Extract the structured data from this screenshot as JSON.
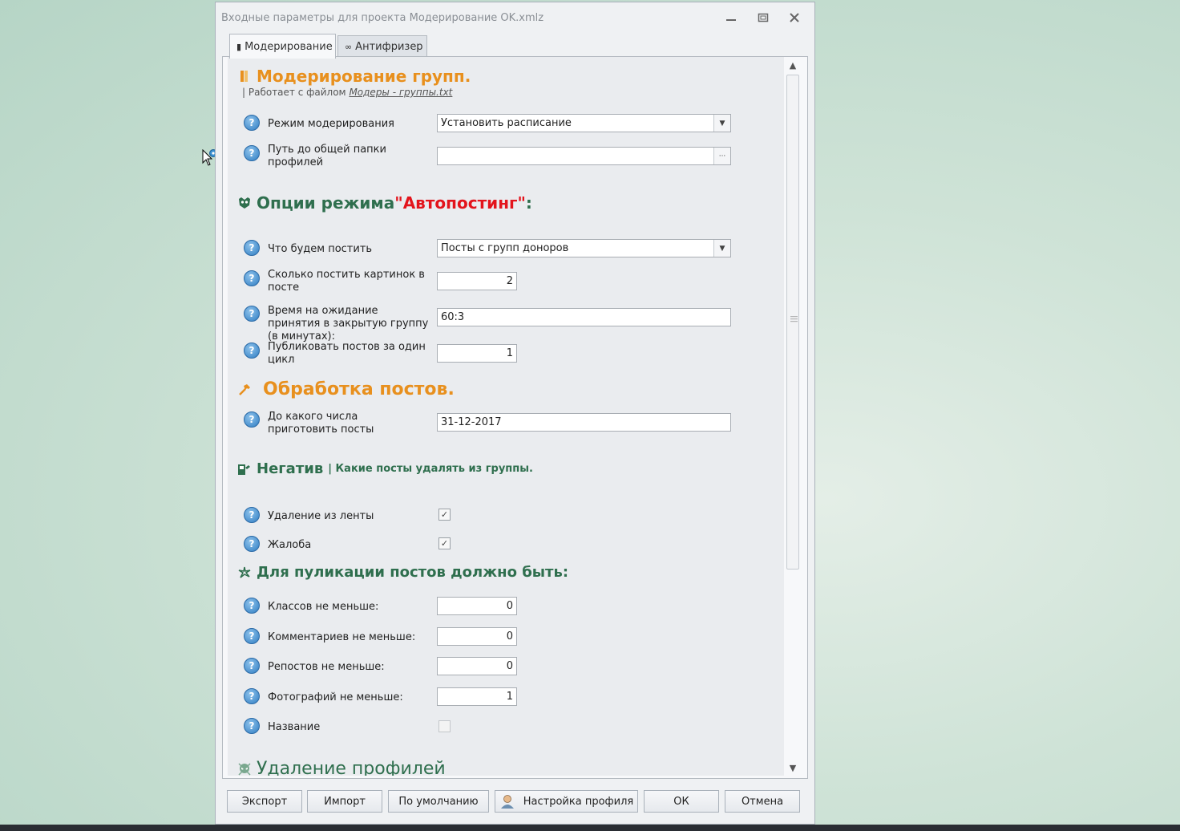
{
  "window": {
    "title": "Входные параметры для проекта Модерирование OK.xmlz",
    "minimize": "—",
    "restore": "❐",
    "close": "✕"
  },
  "tabs": [
    {
      "label": "Модерирование",
      "icon": "▮"
    },
    {
      "label": "Антифризер",
      "icon": "∞"
    }
  ],
  "sections": {
    "moderation": {
      "title": "Модерирование групп.",
      "note_prefix": "| Работает с файлом ",
      "note_link": "Модеры - группы.txt"
    },
    "autopost": {
      "title_prefix": "Опции режима ",
      "title_highlight": "\"Автопостинг\"",
      "title_suffix": ":"
    },
    "processing": {
      "title": "Обработка постов."
    },
    "negative": {
      "title": "Негатив",
      "desc": "| Какие посты удалять из группы."
    },
    "publish": {
      "title": "Для пуликации постов должно быть:"
    },
    "profiles": {
      "title": "Удаление профилей"
    }
  },
  "fields": {
    "mode": {
      "label": "Режим модерирования",
      "value": "Установить расписание"
    },
    "folder": {
      "label": "Путь до общей папки профилей",
      "value": "",
      "dots": "···"
    },
    "what_post": {
      "label": "Что будем постить",
      "value": "Посты с групп доноров"
    },
    "pics": {
      "label": "Сколько постить картинок в посте",
      "value": "2"
    },
    "wait": {
      "label": "Время на ожидание принятия в закрытую группу (в минутах):",
      "value": "60:3"
    },
    "per_cycle": {
      "label": "Публиковать постов за один цикл",
      "value": "1"
    },
    "until": {
      "label": "До какого числа приготовить посты",
      "value": "31-12-2017"
    },
    "del_feed": {
      "label": "Удаление из ленты",
      "checked": true
    },
    "complaint": {
      "label": "Жалоба",
      "checked": true
    },
    "classes": {
      "label": "Классов не меньше:",
      "value": "0"
    },
    "comments": {
      "label": "Комментариев не меньше:",
      "value": "0"
    },
    "reposts": {
      "label": "Репостов не меньше:",
      "value": "0"
    },
    "photos": {
      "label": "Фотографий не меньше:",
      "value": "1"
    },
    "name": {
      "label": "Название",
      "checked": false
    }
  },
  "buttons": {
    "export": "Экспорт",
    "import": "Импорт",
    "default": "По умолчанию",
    "profile": "Настройка профиля",
    "ok": "ОК",
    "cancel": "Отмена"
  },
  "help_glyph": "?",
  "check_glyph": "✓",
  "colors": {
    "orange": "#e8901e",
    "green": "#2f6f4e",
    "red": "#e3141c",
    "help_blue": "#2f7dc2"
  }
}
